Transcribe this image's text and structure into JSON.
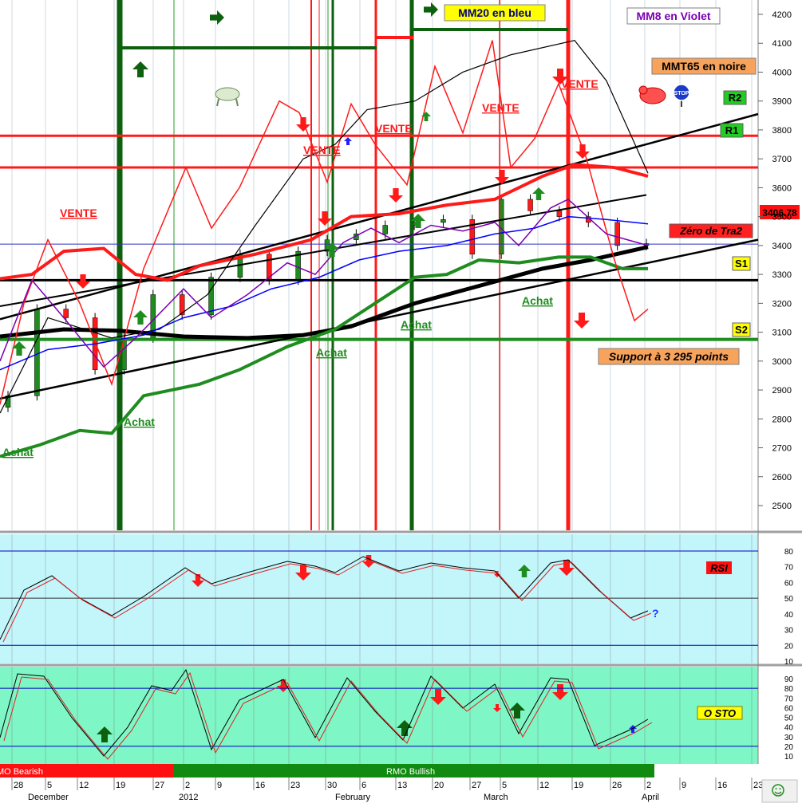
{
  "price_panel": {
    "last_price": "3406.78",
    "legend": [
      {
        "text": "MM20 en bleu",
        "bg": "#ffff00",
        "fg": "#000080"
      },
      {
        "text": "MM8 en Violet",
        "bg": "#ffffff",
        "fg": "#7b00b0"
      },
      {
        "text": "MMT65 en noire",
        "bg": "#f7a35c",
        "fg": "#000000"
      }
    ],
    "levels": [
      {
        "text": "R2",
        "bg": "#22cc22",
        "value": 3850
      },
      {
        "text": "R1",
        "bg": "#22cc22",
        "value": 3650
      },
      {
        "text": "Zéro de Tra2",
        "bg": "#ff2020",
        "value": 3310
      },
      {
        "text": "S1",
        "bg": "#ffff00",
        "value": 3230
      },
      {
        "text": "S2",
        "bg": "#ffff00",
        "value": 3015
      }
    ],
    "support_note": "Support à 3 295 points",
    "signals": [
      {
        "text": "VENTE",
        "kind": "sell"
      },
      {
        "text": "VENTE",
        "kind": "sell"
      },
      {
        "text": "VENTE",
        "kind": "sell"
      },
      {
        "text": "VENTE",
        "kind": "sell"
      },
      {
        "text": "VENTE",
        "kind": "sell"
      },
      {
        "text": "Achat",
        "kind": "buy"
      },
      {
        "text": "Achat",
        "kind": "buy"
      },
      {
        "text": "Achat",
        "kind": "buy"
      },
      {
        "text": "Achat",
        "kind": "buy"
      },
      {
        "text": "Achat",
        "kind": "buy"
      }
    ]
  },
  "rsi_panel": {
    "label": "RSI",
    "question": "?"
  },
  "sto_panel": {
    "label": "O STO"
  },
  "rmo_bar": {
    "bearish": "RMO Bearish",
    "bullish": "RMO Bullish"
  },
  "x_axis": {
    "day_ticks": [
      "28",
      "5",
      "12",
      "19",
      "27",
      "2",
      "9",
      "16",
      "23",
      "30",
      "6",
      "13",
      "20",
      "27",
      "5",
      "12",
      "19",
      "26",
      "2",
      "9",
      "16",
      "23"
    ],
    "month_labels": [
      "December",
      "2012",
      "February",
      "March",
      "April"
    ]
  },
  "colors": {
    "bull": "#1e8c1e",
    "bear": "#ff1a1a",
    "mm20": "#0000ff",
    "mm8": "#7b00b0",
    "mmt65": "#000000",
    "rsi_bg": "#c2f6fb",
    "sto_bg": "#7ff6c6"
  },
  "chart_data": [
    {
      "type": "line",
      "title": "",
      "ylim": [
        2400,
        4250
      ],
      "y_ticks": [
        2500,
        2600,
        2700,
        2800,
        2900,
        3000,
        3100,
        3200,
        3300,
        3400,
        3500,
        3600,
        3700,
        3800,
        3900,
        4000,
        4100,
        4200
      ],
      "x_days": [
        28,
        5,
        12,
        19,
        27,
        2,
        9,
        16,
        23,
        30,
        6,
        13,
        20,
        27,
        5,
        12,
        19,
        26,
        2
      ],
      "series": [
        {
          "name": "MM20 en bleu",
          "values": [
            2980,
            3000,
            3080,
            3100,
            3120,
            3160,
            3200,
            3270,
            3330,
            3390,
            3440,
            3470,
            3490,
            3500,
            3480,
            3470,
            3510,
            3500,
            3480
          ]
        },
        {
          "name": "MM8 en Violet",
          "values": [
            3000,
            3250,
            3050,
            2980,
            3100,
            3220,
            3180,
            3340,
            3380,
            3300,
            3460,
            3450,
            3520,
            3520,
            3480,
            3410,
            3530,
            3460,
            3400
          ]
        },
        {
          "name": "MMT65 en noire",
          "values": [
            2950,
            3180,
            3100,
            3000,
            3050,
            3140,
            3300,
            3580,
            3660,
            3730,
            3820,
            3880,
            3990,
            4010,
            4080,
            4100,
            4040,
            3910,
            3730
          ]
        }
      ],
      "candles_close": [
        2880,
        3180,
        3150,
        2970,
        3080,
        3230,
        3160,
        3290,
        3370,
        3280,
        3380,
        3420,
        3440,
        3470,
        3480,
        3490,
        3370,
        3560,
        3520,
        3500,
        3480,
        3400,
        3406.78
      ]
    },
    {
      "type": "line",
      "title": "RSI",
      "ylim": [
        10,
        85
      ],
      "y_ticks": [
        10,
        20,
        30,
        40,
        50,
        60,
        70,
        80
      ],
      "reference_lines": [
        20,
        50,
        80
      ],
      "x_days": [
        28,
        5,
        12,
        19,
        27,
        2,
        9,
        16,
        23,
        30,
        6,
        13,
        20,
        27,
        5,
        12,
        19,
        26,
        2
      ],
      "series": [
        {
          "values": [
            25,
            55,
            62,
            50,
            40,
            52,
            62,
            66,
            71,
            72,
            64,
            76,
            72,
            70,
            72,
            52,
            71,
            58,
            40
          ]
        }
      ]
    },
    {
      "type": "line",
      "title": "O STO",
      "ylim": [
        0,
        100
      ],
      "y_ticks": [
        10,
        20,
        30,
        40,
        50,
        60,
        70,
        80,
        90
      ],
      "reference_lines": [
        20,
        80
      ],
      "x_days": [
        28,
        5,
        12,
        19,
        27,
        2,
        9,
        16,
        23,
        30,
        6,
        13,
        20,
        27,
        5,
        12,
        19,
        26,
        2
      ],
      "series": [
        {
          "values": [
            30,
            90,
            80,
            40,
            10,
            70,
            95,
            40,
            85,
            75,
            30,
            80,
            30,
            85,
            70,
            40,
            90,
            25,
            35
          ]
        }
      ]
    }
  ]
}
